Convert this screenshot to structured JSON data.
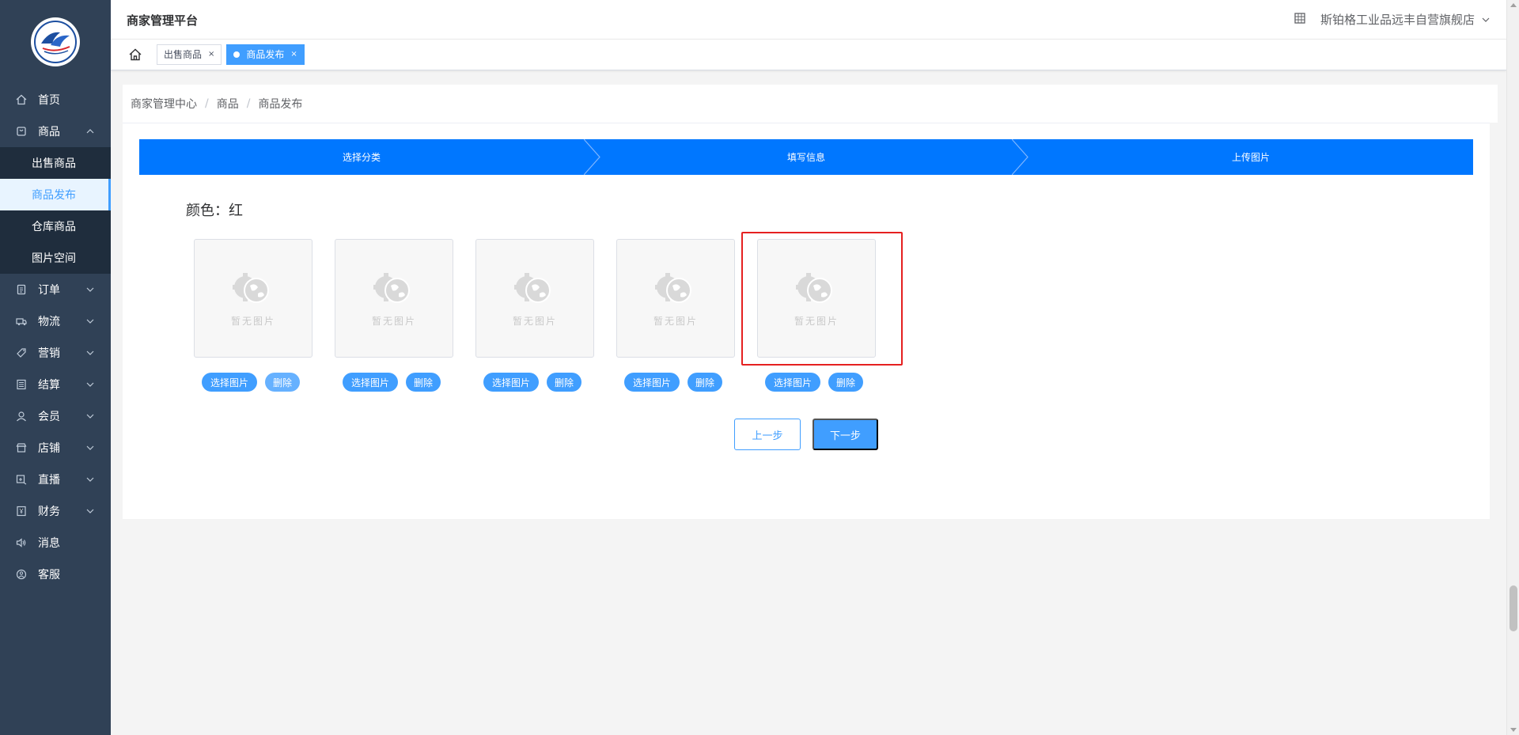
{
  "header": {
    "platform_title": "商家管理平台",
    "store_name": "斯铂格工业品远丰自营旗舰店"
  },
  "tags": {
    "items": [
      {
        "label": "出售商品",
        "close": "×"
      },
      {
        "label": "商品发布",
        "close": "×"
      }
    ]
  },
  "sidebar": {
    "items": [
      {
        "label": "首页",
        "icon": "home-icon"
      },
      {
        "label": "商品",
        "icon": "goods-icon"
      },
      {
        "label": "订单",
        "icon": "order-icon"
      },
      {
        "label": "物流",
        "icon": "truck-icon"
      },
      {
        "label": "营销",
        "icon": "tag-icon"
      },
      {
        "label": "结算",
        "icon": "ledger-icon"
      },
      {
        "label": "会员",
        "icon": "user-icon"
      },
      {
        "label": "店铺",
        "icon": "store-icon"
      },
      {
        "label": "直播",
        "icon": "live-icon"
      },
      {
        "label": "财务",
        "icon": "finance-icon"
      },
      {
        "label": "消息",
        "icon": "sound-icon"
      },
      {
        "label": "客服",
        "icon": "service-icon"
      }
    ],
    "goods_sub": [
      {
        "label": "出售商品"
      },
      {
        "label": "商品发布"
      },
      {
        "label": "仓库商品"
      },
      {
        "label": "图片空间"
      }
    ]
  },
  "breadcrumb": [
    "商家管理中心",
    "商品",
    "商品发布"
  ],
  "breadcrumb_sep": "/",
  "steps": [
    "选择分类",
    "填写信息",
    "上传图片"
  ],
  "color_label": "颜色：红",
  "image_slots": {
    "placeholder": "暂无图片",
    "select_label": "选择图片",
    "delete_label": "删除"
  },
  "actions": {
    "prev": "上一步",
    "next": "下一步"
  },
  "colors": {
    "sidebar_bg": "#304156",
    "submenu_bg": "#1f2d3d",
    "accent": "#409eff",
    "steps_bg": "#0077ff",
    "highlight": "#e52020"
  }
}
